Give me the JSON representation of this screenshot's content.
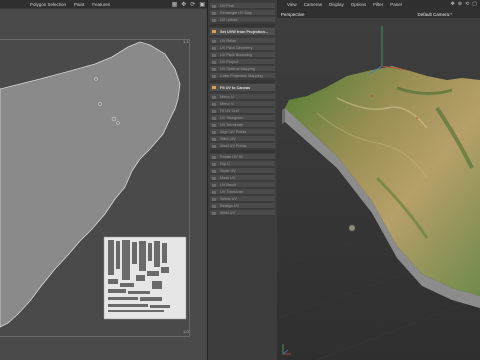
{
  "uv_editor": {
    "menu": [
      "Polygon Selection",
      "Paint",
      "Features"
    ],
    "toolbar_icons": [
      "grid-icon",
      "move-icon",
      "rotate-icon",
      "lock-icon"
    ],
    "corner_top": "1,1",
    "corner_bottom": "1,0"
  },
  "tools": {
    "items": [
      {
        "label": "UV Peel",
        "active": false
      },
      {
        "label": "Rectangle UV Map",
        "active": false
      },
      {
        "label": "UV Unfold",
        "active": false
      },
      {
        "label": "Set UVW from Projection...",
        "active": true
      },
      {
        "label": "UV Relax",
        "active": false
      },
      {
        "label": "UV Pack Geometry",
        "active": false
      },
      {
        "label": "UV Pack Bounding",
        "active": false
      },
      {
        "label": "UV Project",
        "active": false
      },
      {
        "label": "UV Optimal Mapping",
        "active": false
      },
      {
        "label": "Cube Projection Mapping",
        "active": false
      },
      {
        "label": "Fit UV to Canvas",
        "active": true
      },
      {
        "label": "Mirror U",
        "active": false
      },
      {
        "label": "Mirror V",
        "active": false
      },
      {
        "label": "Fit UV Grid",
        "active": false
      },
      {
        "label": "UV Straighten",
        "active": false
      },
      {
        "label": "UV Terminate",
        "active": false
      },
      {
        "label": "Align UV Points",
        "active": false
      },
      {
        "label": "Stitch UV",
        "active": false
      },
      {
        "label": "Weld UV Points",
        "active": false
      },
      {
        "label": "Rotate UV 90",
        "active": false
      },
      {
        "label": "Flip U",
        "active": false
      },
      {
        "label": "Scale UV",
        "active": false
      },
      {
        "label": "Mask UV",
        "active": false
      },
      {
        "label": "UV Brush",
        "active": false
      },
      {
        "label": "UV Transform",
        "active": false
      },
      {
        "label": "Select UV",
        "active": false
      },
      {
        "label": "Realign UV",
        "active": false
      },
      {
        "label": "Weld UV",
        "active": false
      }
    ]
  },
  "viewport": {
    "menu": [
      "View",
      "Cameras",
      "Display",
      "Options",
      "Filter",
      "Panel"
    ],
    "label": "Perspective",
    "camera": "Default Camera",
    "camera_symbol": ":*",
    "icons": [
      "move-icon",
      "zoom-icon",
      "rotate-icon",
      "maximize-icon"
    ],
    "colors": {
      "axis_y": "#3fae62",
      "axis_x": "#c0463a",
      "terrain_green": "#5e8a3a",
      "terrain_tan": "#b89b62"
    }
  }
}
